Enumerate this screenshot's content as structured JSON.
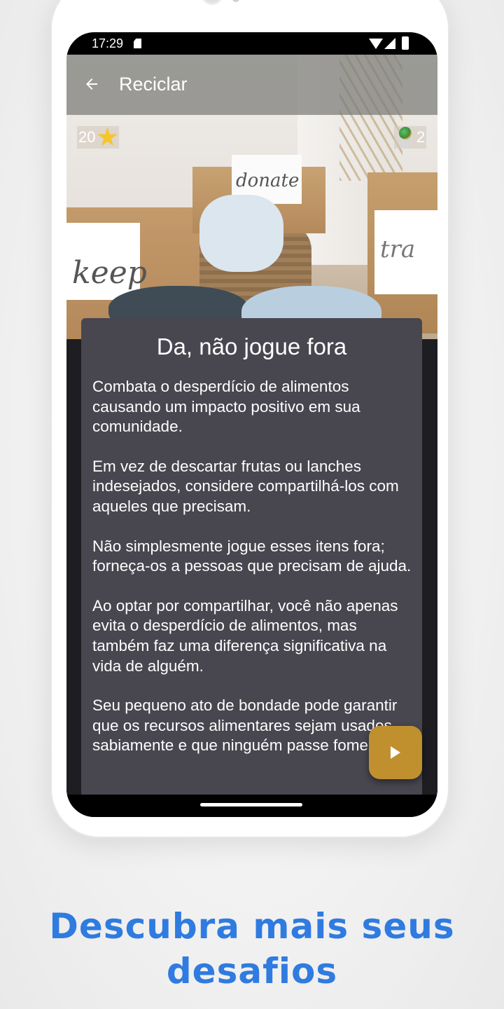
{
  "status_bar": {
    "time": "17:29"
  },
  "app_bar": {
    "title": "Reciclar",
    "back_icon": "arrow-left-icon"
  },
  "hero_image": {
    "label_left": "keep",
    "label_middle": "donate",
    "label_right": "tra"
  },
  "badges": {
    "points": "20",
    "points_icon": "star-icon",
    "medals": "2",
    "medals_icon": "medal-icon"
  },
  "card": {
    "title": "Da, não jogue fora",
    "paragraphs": [
      "Combata o desperdício de alimentos causando um impacto positivo em sua comunidade.",
      "Em vez de descartar frutas ou lanches indesejados, considere compartilhá-los com aqueles que precisam.",
      "Não simplesmente jogue esses itens fora; forneça-os a pessoas que precisam de ajuda.",
      "Ao optar por compartilhar, você não apenas evita o desperdício de alimentos, mas também faz uma diferença significativa na vida de alguém.",
      "Seu pequeno ato de bondade pode garantir que os recursos alimentares sejam usados sabiamente e que ninguém passe fome."
    ]
  },
  "fab": {
    "icon": "play-icon",
    "color": "#c0902f"
  },
  "promo": {
    "headline": "Descubra mais seus desafios",
    "color": "#2f7be0"
  },
  "colors": {
    "card_bg": "#48464f",
    "screen_bg": "#1e1d22"
  }
}
